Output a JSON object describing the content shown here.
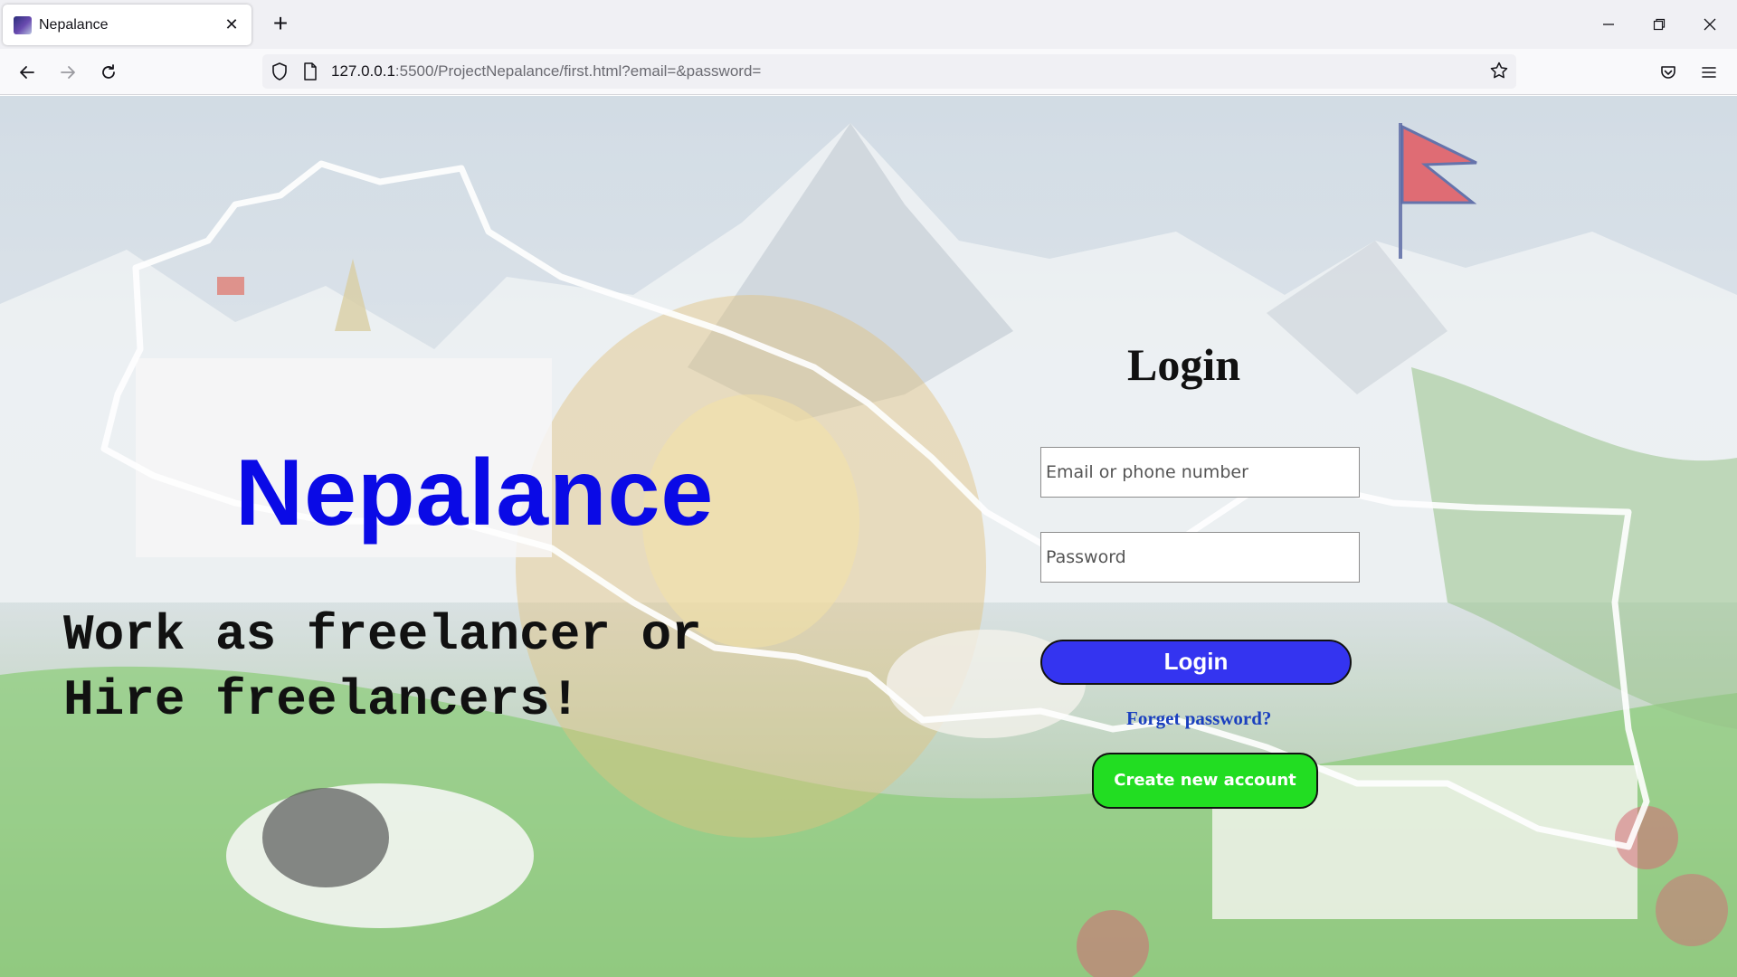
{
  "browser": {
    "tab": {
      "title": "Nepalance",
      "close_label": "✕"
    },
    "new_tab_label": "+",
    "url": {
      "host": "127.0.0.1",
      "path": ":5500/ProjectNepalance/first.html?email=&password="
    },
    "icons": [
      "back-icon",
      "forward-icon",
      "reload-icon",
      "shield-icon",
      "page-icon",
      "star-icon",
      "pocket-icon",
      "menu-icon",
      "minimize-icon",
      "maximize-icon",
      "close-icon"
    ]
  },
  "page": {
    "brand": "Nepalance",
    "tagline_line1": "Work as freelancer or",
    "tagline_line2": "Hire freelancers!",
    "login": {
      "heading": "Login",
      "email_placeholder": "Email or phone number",
      "password_placeholder": "Password",
      "submit_label": "Login",
      "forgot_label": "Forget password?",
      "create_label": "Create new account"
    }
  },
  "colors": {
    "brand_blue": "#0a0ae6",
    "login_button": "#3434f0",
    "create_button": "#22dd22",
    "forgot_link": "#1a3fbf"
  }
}
